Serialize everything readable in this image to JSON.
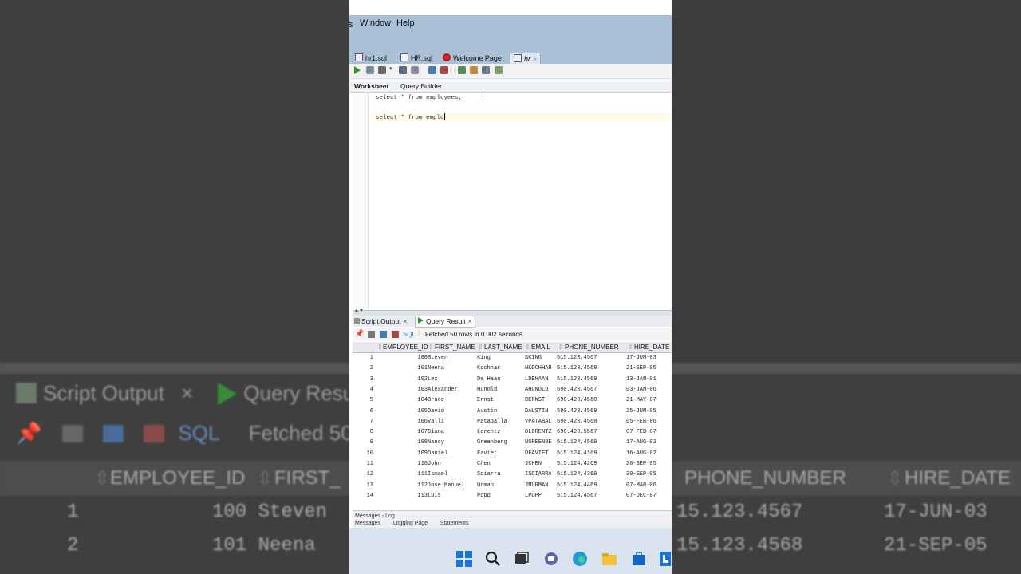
{
  "menu": {
    "cut": "s",
    "window": "Window",
    "help": "Help"
  },
  "tabs": [
    {
      "label": "hr1.sql",
      "icon": "sql-file-icon"
    },
    {
      "label": "HR.sql",
      "icon": "sql-file-icon"
    },
    {
      "label": "Welcome Page",
      "icon": "oracle-icon"
    },
    {
      "label": "hr",
      "icon": "database-connection-icon"
    }
  ],
  "subtabs": {
    "worksheet": "Worksheet",
    "query_builder": "Query Builder"
  },
  "editor": {
    "line1": "select * from employees;",
    "line2": "select * from emplo"
  },
  "output_tabs": {
    "script_output": "Script Output",
    "query_result": "Query Result",
    "close": "×"
  },
  "output_toolbar": {
    "sql": "SQL",
    "status": "Fetched 50 rows in 0.002 seconds"
  },
  "grid": {
    "columns": [
      "EMPLOYEE_ID",
      "FIRST_NAME",
      "LAST_NAME",
      "EMAIL",
      "PHONE_NUMBER",
      "HIRE_DATE"
    ],
    "rows": [
      [
        "1",
        "100",
        "Steven",
        "King",
        "SKING",
        "515.123.4567",
        "17-JUN-03"
      ],
      [
        "2",
        "101",
        "Neena",
        "Kochhar",
        "NKOCHHAR",
        "515.123.4568",
        "21-SEP-05"
      ],
      [
        "3",
        "102",
        "Lex",
        "De Haan",
        "LDEHAAN",
        "515.123.4569",
        "13-JAN-01"
      ],
      [
        "4",
        "103",
        "Alexander",
        "Hunold",
        "AHUNOLD",
        "590.423.4567",
        "03-JAN-06"
      ],
      [
        "5",
        "104",
        "Bruce",
        "Ernst",
        "BERNST",
        "590.423.4568",
        "21-MAY-07"
      ],
      [
        "6",
        "105",
        "David",
        "Austin",
        "DAUSTIN",
        "590.423.4569",
        "25-JUN-05"
      ],
      [
        "7",
        "106",
        "Valli",
        "Pataballa",
        "VPATABAL",
        "590.423.4560",
        "05-FEB-06"
      ],
      [
        "8",
        "107",
        "Diana",
        "Lorentz",
        "DLORENTZ",
        "590.423.5567",
        "07-FEB-07"
      ],
      [
        "9",
        "108",
        "Nancy",
        "Greenberg",
        "NGREENBE",
        "515.124.4569",
        "17-AUG-02"
      ],
      [
        "10",
        "109",
        "Daniel",
        "Faviet",
        "DFAVIET",
        "515.124.4169",
        "16-AUG-02"
      ],
      [
        "11",
        "110",
        "John",
        "Chen",
        "JCHEN",
        "515.124.4269",
        "28-SEP-05"
      ],
      [
        "12",
        "111",
        "Ismael",
        "Sciarra",
        "ISCIARRA",
        "515.124.4369",
        "30-SEP-05"
      ],
      [
        "13",
        "112",
        "Jose Manuel",
        "Urman",
        "JMURMAN",
        "515.124.4469",
        "07-MAR-06"
      ],
      [
        "14",
        "113",
        "Luis",
        "Popp",
        "LPOPP",
        "515.124.4567",
        "07-DEC-07"
      ]
    ]
  },
  "bottom": {
    "title": "Messages - Log",
    "tabs": [
      "Messages",
      "Logging Page",
      "Statements"
    ]
  },
  "bg": {
    "script_output": "Script Output",
    "close": "×",
    "query_result": "Query Resu",
    "sql": "SQL",
    "fetched": "Fetched 50",
    "col_employee_id": "EMPLOYEE_ID",
    "col_first": "FIRST_",
    "col_phone": "PHONE_NUMBER",
    "col_hire": "HIRE_DATE",
    "left_rows": [
      {
        "num": "1",
        "text": "100 Steven"
      },
      {
        "num": "2",
        "text": "101 Neena"
      }
    ],
    "right_rows": [
      {
        "phone": "15.123.4567",
        "date": "17-JUN-03"
      },
      {
        "phone": "15.123.4568",
        "date": "21-SEP-05"
      }
    ]
  }
}
